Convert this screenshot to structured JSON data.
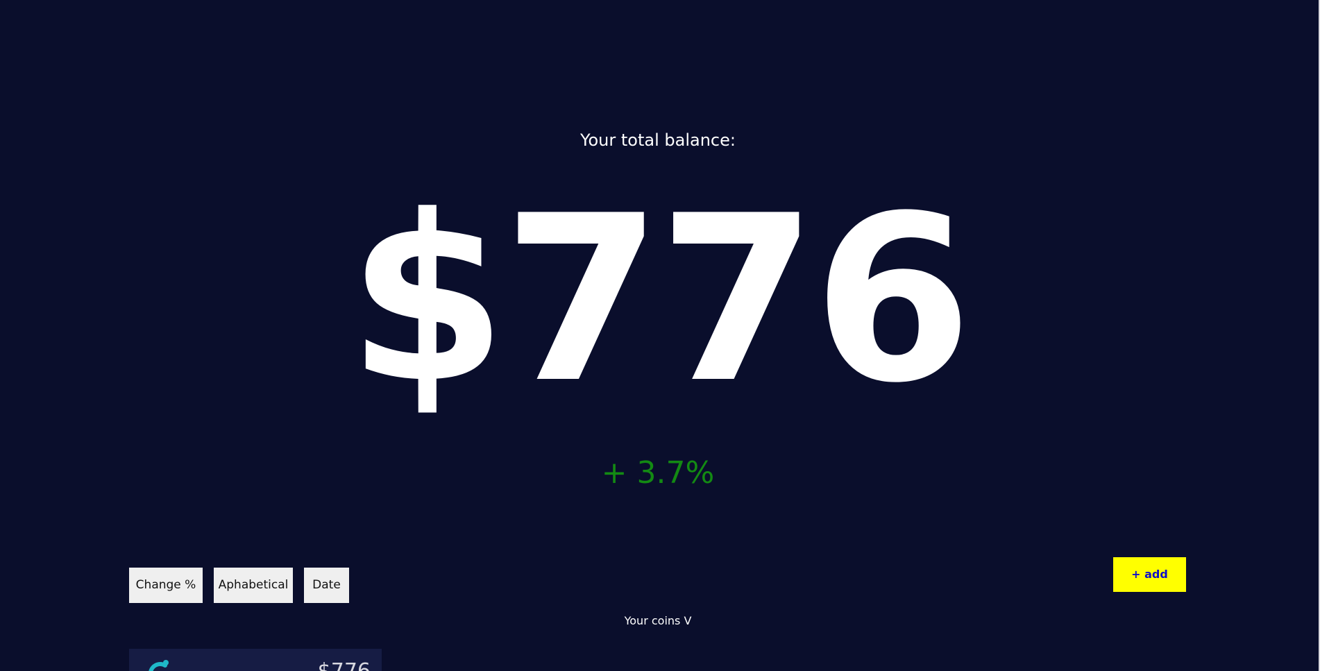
{
  "balance": {
    "label": "Your total balance:",
    "amount": "$776",
    "change": "+ 3.7%"
  },
  "sort_buttons": {
    "change": "Change %",
    "alphabetical": "Aphabetical",
    "date": "Date"
  },
  "add_button": "+ add",
  "coins_toggle": "Your coins V",
  "coins": [
    {
      "value": "$776",
      "icon": "coin-logo-icon"
    }
  ],
  "colors": {
    "background": "#0a0e2c",
    "positive_change": "#138a13",
    "add_button_bg": "#ffff00",
    "add_button_text": "#1010c8",
    "card_bg": "#161c44",
    "coin_icon": "#1fb8c8"
  }
}
